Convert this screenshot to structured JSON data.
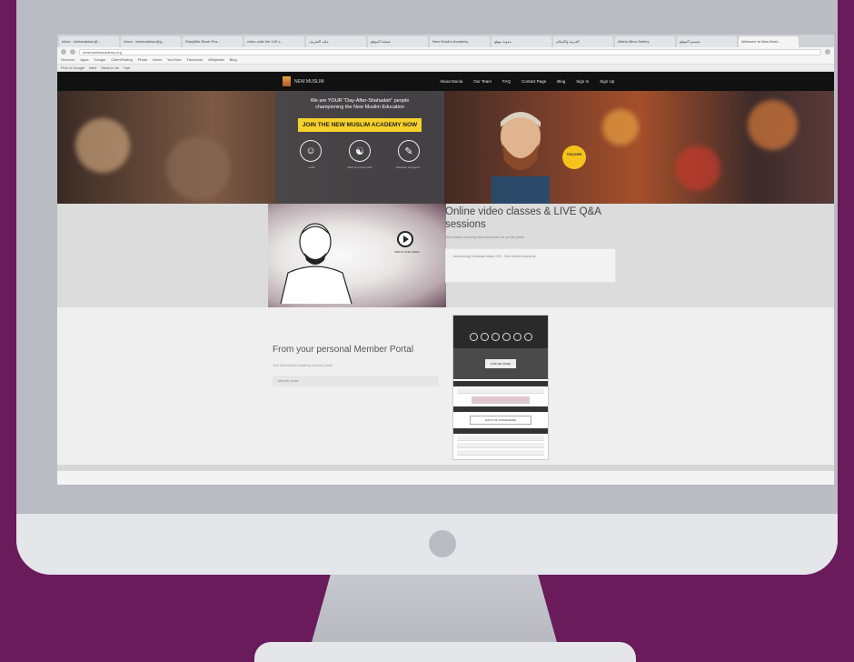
{
  "browser": {
    "tabs": [
      "Inbox - farhanakhan@...",
      "Inbox - farhanakhan@g...",
      "ReplyBtn Blush Pos...",
      "video calls the 140 v...",
      "ملف التعريف",
      "صفحة الموقع",
      "New Muslim Academy",
      "مدونة موقع",
      "العربية والإسلام",
      "Alisha Mina Gallery",
      "تصميم الموقع",
      "Welcome to New Musl..."
    ],
    "url": "newmuslimacademy.org",
    "bookmarks": [
      "Services",
      "Apps",
      "Google",
      "ClaimFinding",
      "Photo",
      "Inbox",
      "YouTube",
      "Facebook",
      "Wikipedia",
      "Blog"
    ],
    "find_bar": [
      "Find in Google",
      "Next",
      "Show in all",
      "Tips"
    ]
  },
  "site": {
    "logo_text": "NEW MUSLIM",
    "menu": [
      "About Munia",
      "Our Team",
      "FAQ",
      "Contact Page",
      "Blog",
      "Sign In",
      "Sign Up"
    ],
    "hero": {
      "line1": "We are YOUR \"Day-After-Shahadah\" people",
      "line2": "championing the New Muslim Education",
      "cta": "JOIN THE NEW MUSLIM ACADEMY NOW",
      "circle_icons": [
        "person-icon",
        "group-icon",
        "edit-icon"
      ],
      "circle_labels": [
        "Learn",
        "Meet & connect with",
        "Volunteer & support"
      ],
      "badge": "TEACHER"
    },
    "video": {
      "watch_label": "WATCH THE VIDEO",
      "title": "Online video classes & LIVE Q&A sessions",
      "desc": "New Muslim Academy class schedules on our live portal",
      "box": "Announcing Shahadah class LIVE - New Muslim Academy"
    },
    "portal": {
      "title": "From your personal Member Portal",
      "desc": "Your New Muslim Academy member portal",
      "note": "Member portal",
      "shot_btn": "FIND ME MORE",
      "shot_gift": "GIFTS OF KNOWLEDGE"
    }
  }
}
